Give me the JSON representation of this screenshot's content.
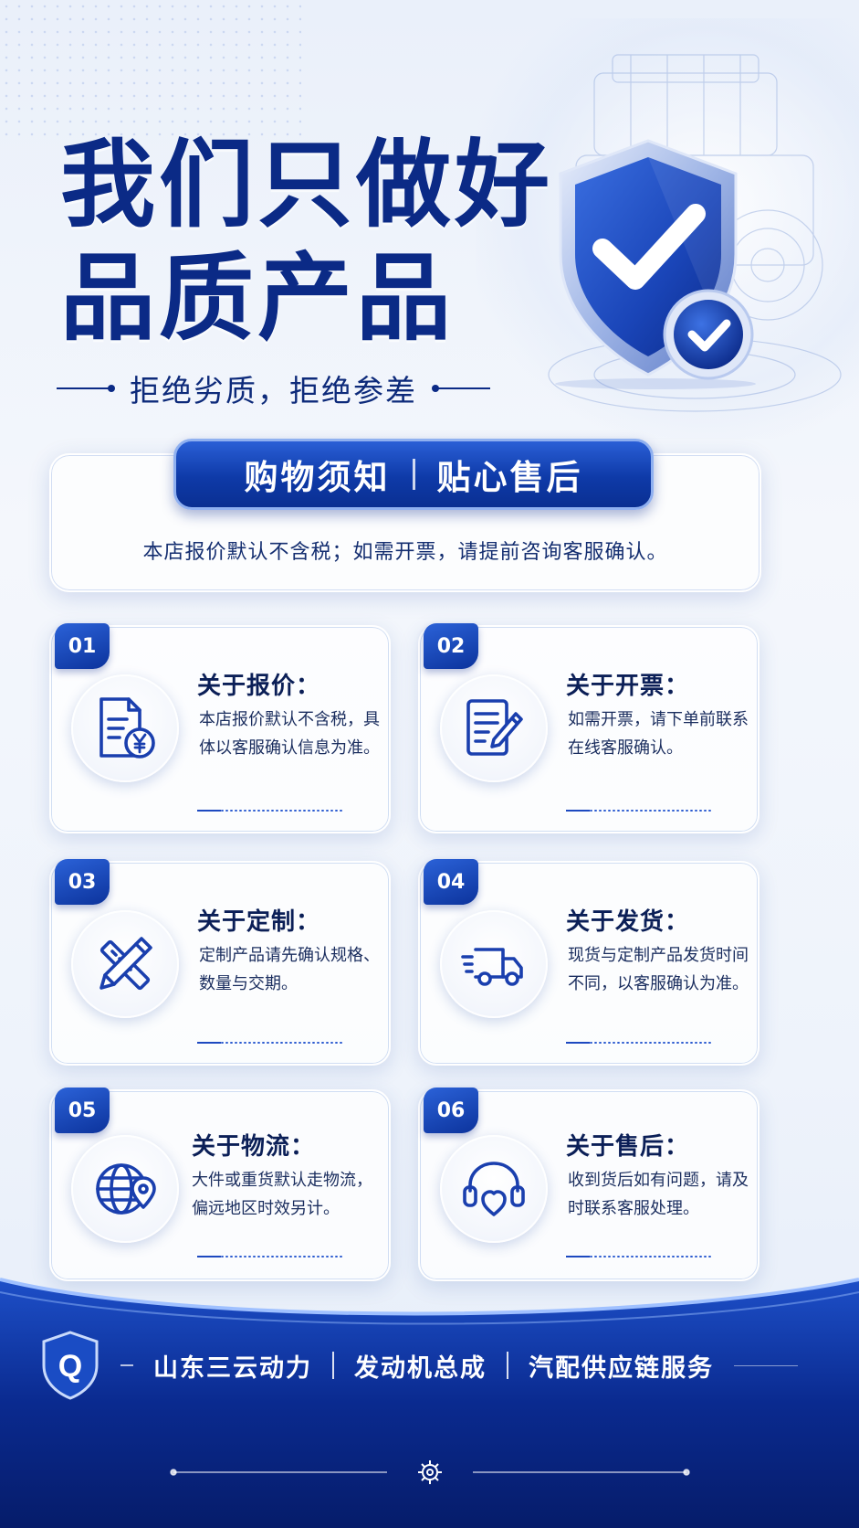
{
  "headline": {
    "line1": "我们只做好",
    "line2": "品质产品"
  },
  "subtitle": "拒绝劣质，拒绝参差",
  "notice": {
    "banner_left": "购物须知",
    "banner_right": "贴心售后",
    "text": "本店报价默认不含税；如需开票，请提前咨询客服确认。"
  },
  "cards": [
    {
      "number": "01",
      "title": "关于报价：",
      "body": "本店报价默认不含税，具体以客服确认信息为准。",
      "icon": "quote-document-yen-icon"
    },
    {
      "number": "02",
      "title": "关于开票：",
      "body": "如需开票，请下单前联系在线客服确认。",
      "icon": "invoice-pen-icon"
    },
    {
      "number": "03",
      "title": "关于定制：",
      "body": "定制产品请先确认规格、数量与交期。",
      "icon": "ruler-pencil-icon"
    },
    {
      "number": "04",
      "title": "关于发货：",
      "body": "现货与定制产品发货时间不同，以客服确认为准。",
      "icon": "delivery-truck-icon"
    },
    {
      "number": "05",
      "title": "关于物流：",
      "body": "大件或重货默认走物流，偏远地区时效另计。",
      "icon": "globe-location-icon"
    },
    {
      "number": "06",
      "title": "关于售后：",
      "body": "收到货后如有问题，请及时联系客服处理。",
      "icon": "headset-heart-icon"
    }
  ],
  "footer": {
    "logo_letter": "Q",
    "tag1": "山东三云动力",
    "tag2": "发动机总成",
    "tag3": "汽配供应链服务"
  },
  "colors": {
    "brand_blue": "#0b2a86",
    "accent_blue": "#1d49c0",
    "footer_blue": "#0a2a8f"
  }
}
